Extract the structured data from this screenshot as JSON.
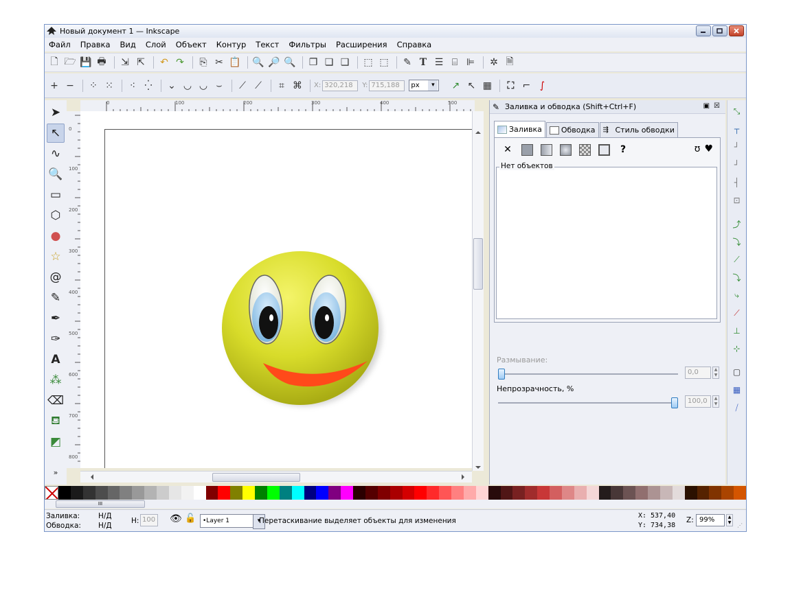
{
  "window": {
    "title": "Новый документ 1 — Inkscape",
    "controls": [
      "minimize",
      "maximize",
      "close"
    ]
  },
  "menu": [
    "Файл",
    "Правка",
    "Вид",
    "Слой",
    "Объект",
    "Контур",
    "Текст",
    "Фильтры",
    "Расширения",
    "Справка"
  ],
  "toolbar_node": {
    "x_label": "X:",
    "x_value": "320,218",
    "y_label": "Y:",
    "y_value": "715,188",
    "unit": "px"
  },
  "ruler": {
    "top_ticks": [
      "0",
      "100",
      "200",
      "300",
      "400",
      "500"
    ],
    "left_ticks": [
      "0",
      "100",
      "200",
      "300",
      "400",
      "500",
      "600",
      "700",
      "800"
    ]
  },
  "fill_stroke_panel": {
    "title": "Заливка и обводка (Shift+Ctrl+F)",
    "tabs": [
      "Заливка",
      "Обводка",
      "Стиль обводки"
    ],
    "no_objects": "Нет объектов",
    "blur_label": "Размывание:",
    "blur_value": "0,0",
    "opacity_label": "Непрозрачность, %",
    "opacity_value": "100,0",
    "opacity_level": 1.0,
    "blur_level": 0.0
  },
  "statusbar": {
    "fill_label": "Заливка:",
    "fill_value": "Н/Д",
    "stroke_label": "Обводка:",
    "stroke_value": "Н/Д",
    "h_label": "Н:",
    "h_value": "100",
    "layer": "•Layer 1",
    "message": "Перетаскивание выделяет объекты для изменения",
    "x_label": "X:",
    "x_value": "537,40",
    "y_label": "Y:",
    "y_value": "734,38",
    "zoom_label": "Z:",
    "zoom_value": "99%"
  },
  "palette_colors": [
    "#000000",
    "#1a1a1a",
    "#333333",
    "#4d4d4d",
    "#666666",
    "#808080",
    "#999999",
    "#b3b3b3",
    "#cccccc",
    "#e6e6e6",
    "#f2f2f2",
    "#ffffff",
    "#800000",
    "#ff0000",
    "#808000",
    "#ffff00",
    "#008000",
    "#00ff00",
    "#008080",
    "#00ffff",
    "#000080",
    "#0000ff",
    "#800080",
    "#ff00ff",
    "#2b0000",
    "#550000",
    "#800000",
    "#aa0000",
    "#d40000",
    "#ff0000",
    "#ff2a2a",
    "#ff5555",
    "#ff8080",
    "#ffaaaa",
    "#ffd5d5",
    "#280b0b",
    "#501616",
    "#782121",
    "#a02c2c",
    "#c83737",
    "#d35f5f",
    "#de8787",
    "#e9afaf",
    "#f4d7d7",
    "#241c1c",
    "#483737",
    "#6c5353",
    "#916f6f",
    "#ac9393",
    "#c8b7b7",
    "#e3dbdb",
    "#2b1100",
    "#552200",
    "#803300",
    "#aa4400",
    "#d45500"
  ]
}
